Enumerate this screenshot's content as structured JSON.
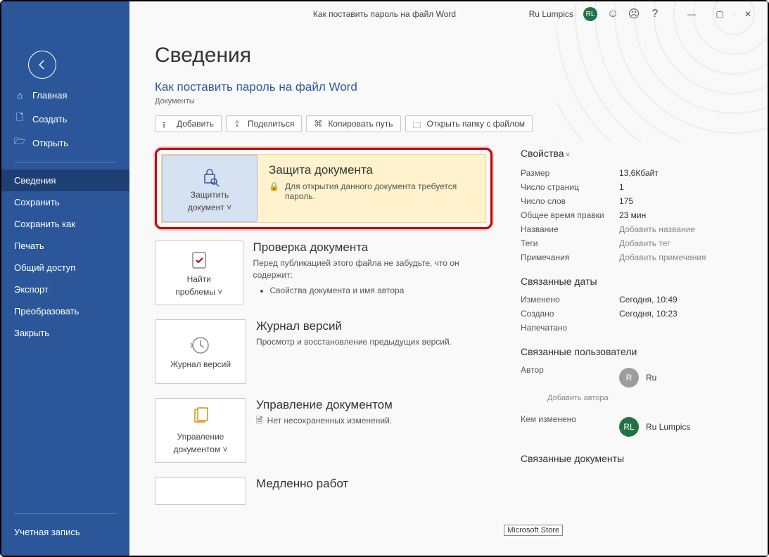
{
  "titlebar": {
    "title": "Как поставить пароль на файл Word",
    "username": "Ru Lumpics",
    "avatar_initials": "RL"
  },
  "sidebar": {
    "top": [
      {
        "label": "Главная",
        "icon": "home"
      },
      {
        "label": "Создать",
        "icon": "file"
      },
      {
        "label": "Открыть",
        "icon": "folder-open"
      }
    ],
    "mid": [
      {
        "label": "Сведения",
        "active": true
      },
      {
        "label": "Сохранить"
      },
      {
        "label": "Сохранить как"
      },
      {
        "label": "Печать"
      },
      {
        "label": "Общий доступ"
      },
      {
        "label": "Экспорт"
      },
      {
        "label": "Преобразовать"
      },
      {
        "label": "Закрыть"
      }
    ],
    "bottom": [
      {
        "label": "Учетная запись"
      }
    ]
  },
  "page": {
    "heading": "Сведения",
    "doc_title": "Как поставить пароль на файл Word",
    "doc_path": "Документы",
    "toolbar": {
      "upload": "Добавить",
      "share": "Поделиться",
      "copy_path": "Копировать путь",
      "open_folder": "Открыть папку с файлом"
    },
    "protect": {
      "btn_line1": "Защитить",
      "btn_line2": "документ",
      "title": "Защита документа",
      "desc": "Для открытия данного документа требуется пароль."
    },
    "inspect": {
      "btn_line1": "Найти",
      "btn_line2": "проблемы",
      "title": "Проверка документа",
      "desc": "Перед публикацией этого файла не забудьте, что он содержит:",
      "bullet1": "Свойства документа и имя автора"
    },
    "versions": {
      "btn_label": "Журнал версий",
      "title": "Журнал версий",
      "desc": "Просмотр и восстановление предыдущих версий."
    },
    "manage": {
      "btn_line1": "Управление",
      "btn_line2": "документом",
      "title": "Управление документом",
      "desc": "Нет несохраненных изменений."
    },
    "slow": {
      "title": "Медленно работ"
    },
    "tooltip": "Microsoft Store"
  },
  "props": {
    "heading": "Свойства",
    "rows": [
      {
        "label": "Размер",
        "value": "13,6Кбайт"
      },
      {
        "label": "Число страниц",
        "value": "1"
      },
      {
        "label": "Число слов",
        "value": "175"
      },
      {
        "label": "Общее время правки",
        "value": "23 мин"
      },
      {
        "label": "Название",
        "value": "Добавить название",
        "placeholder": true
      },
      {
        "label": "Теги",
        "value": "Добавить тег",
        "placeholder": true
      },
      {
        "label": "Примечания",
        "value": "Добавить примечания",
        "placeholder": true
      }
    ],
    "dates_heading": "Связанные даты",
    "dates": [
      {
        "label": "Изменено",
        "value": "Сегодня, 10:49"
      },
      {
        "label": "Создано",
        "value": "Сегодня, 10:23"
      },
      {
        "label": "Напечатано",
        "value": ""
      }
    ],
    "people_heading": "Связанные пользователи",
    "author_label": "Автор",
    "author_initial": "R",
    "author_name": "Ru",
    "add_author": "Добавить автора",
    "modified_label": "Кем изменено",
    "modified_initials": "RL",
    "modified_name": "Ru Lumpics",
    "docs_heading": "Связанные документы"
  }
}
